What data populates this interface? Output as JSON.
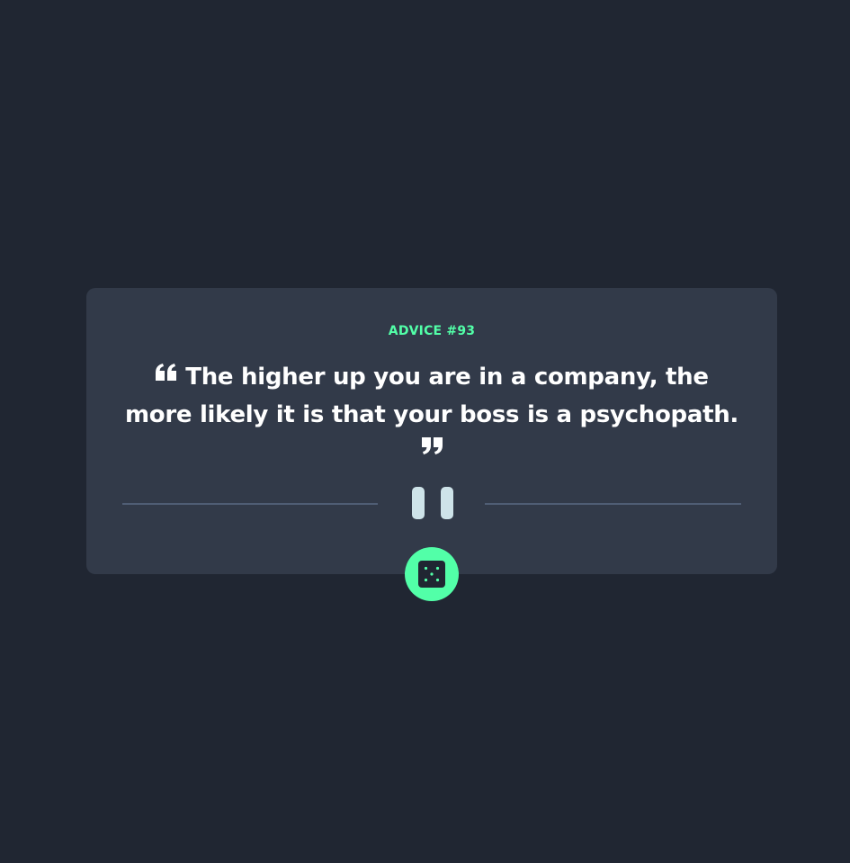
{
  "card": {
    "advice_label": "ADVICE #93",
    "quote": "The higher up you are in a company, the more likely it is that your boss is a psychopath."
  },
  "icons": {
    "open_quote": "quote-open-icon",
    "close_quote": "quote-close-icon",
    "divider": "pause-icon",
    "button": "dice-icon"
  },
  "colors": {
    "background": "#202632",
    "card": "#323a49",
    "accent": "#52ffa8",
    "text": "#ffffff",
    "divider": "#4f5d74",
    "pause": "#cee3e9"
  }
}
